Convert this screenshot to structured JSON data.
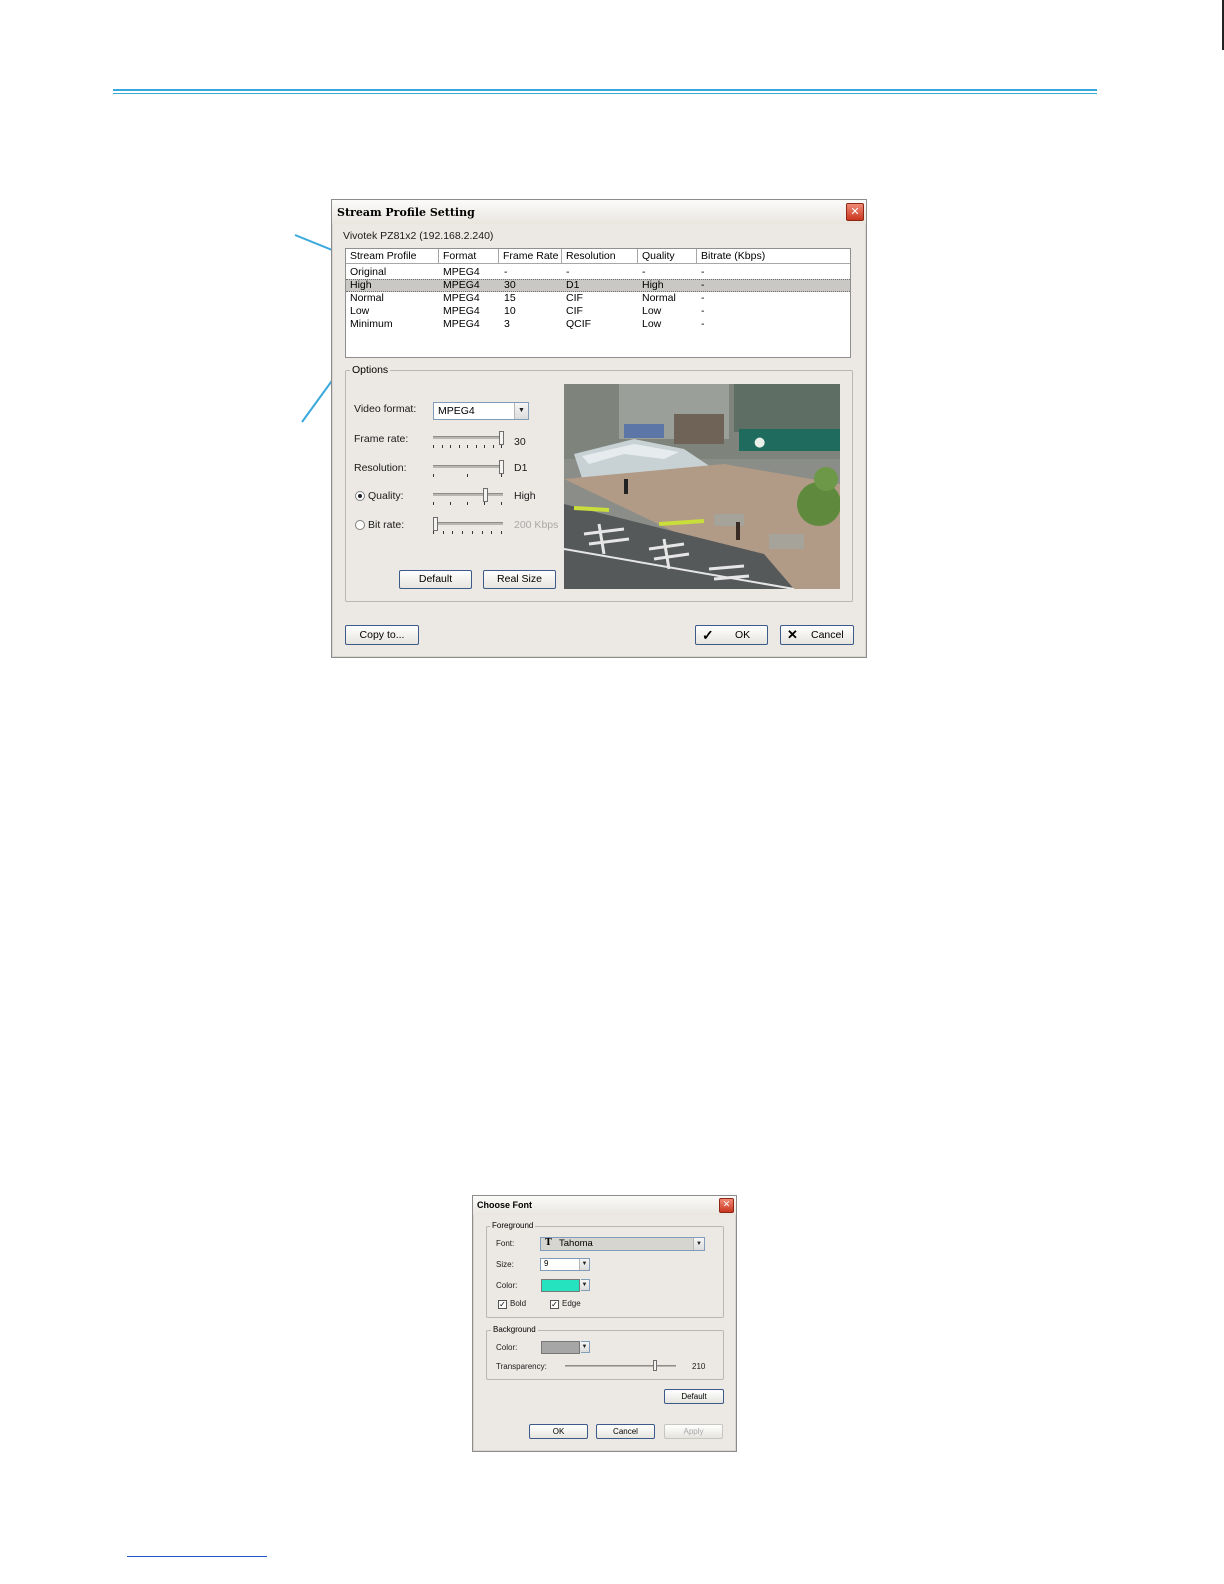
{
  "stream_dialog": {
    "title": "Stream Profile Setting",
    "close_label": "✕",
    "camera_label": "Vivotek PZ81x2 (192.168.2.240)",
    "columns": [
      "Stream Profile",
      "Format",
      "Frame Rate",
      "Resolution",
      "Quality",
      "Bitrate (Kbps)"
    ],
    "rows": [
      [
        "Original",
        "MPEG4",
        "-",
        "-",
        "-",
        "-"
      ],
      [
        "High",
        "MPEG4",
        "30",
        "D1",
        "High",
        "-"
      ],
      [
        "Normal",
        "MPEG4",
        "15",
        "CIF",
        "Normal",
        "-"
      ],
      [
        "Low",
        "MPEG4",
        "10",
        "CIF",
        "Low",
        "-"
      ],
      [
        "Minimum",
        "MPEG4",
        "3",
        "QCIF",
        "Low",
        "-"
      ]
    ],
    "selected_row": 1,
    "options_label": "Options",
    "video_format_label": "Video format:",
    "video_format_value": "MPEG4",
    "frame_rate_label": "Frame rate:",
    "frame_rate_value": "30",
    "frame_rate_level": 1.0,
    "resolution_label": "Resolution:",
    "resolution_value": "D1",
    "resolution_level": 1.0,
    "quality_label": "Quality:",
    "quality_value": "High",
    "quality_level": 0.75,
    "bitrate_label": "Bit rate:",
    "bitrate_value": "200 Kbps",
    "bitrate_level": 0.0,
    "default_button": "Default",
    "real_size_button": "Real Size",
    "copy_button": "Copy to...",
    "ok_button": "OK",
    "cancel_button": "Cancel"
  },
  "font_dialog": {
    "title": "Choose Font",
    "close_label": "✕",
    "foreground_label": "Foreground",
    "font_label": "Font:",
    "font_value": "Tahoma",
    "size_label": "Size:",
    "size_value": "9",
    "color_label": "Color:",
    "foreground_color": "#26e3c0",
    "bold_label": "Bold",
    "bold_checked": true,
    "edge_label": "Edge",
    "edge_checked": true,
    "background_label": "Background",
    "bg_color_label": "Color:",
    "background_color": "#a6a6a6",
    "transparency_label": "Transparency:",
    "transparency_value": "210",
    "transparency_level": 0.82,
    "default_button": "Default",
    "ok_button": "OK",
    "cancel_button": "Cancel",
    "apply_button": "Apply"
  },
  "colors": {
    "accent_line": "#38a9dc",
    "footer_link_line": "#1e56c8"
  }
}
